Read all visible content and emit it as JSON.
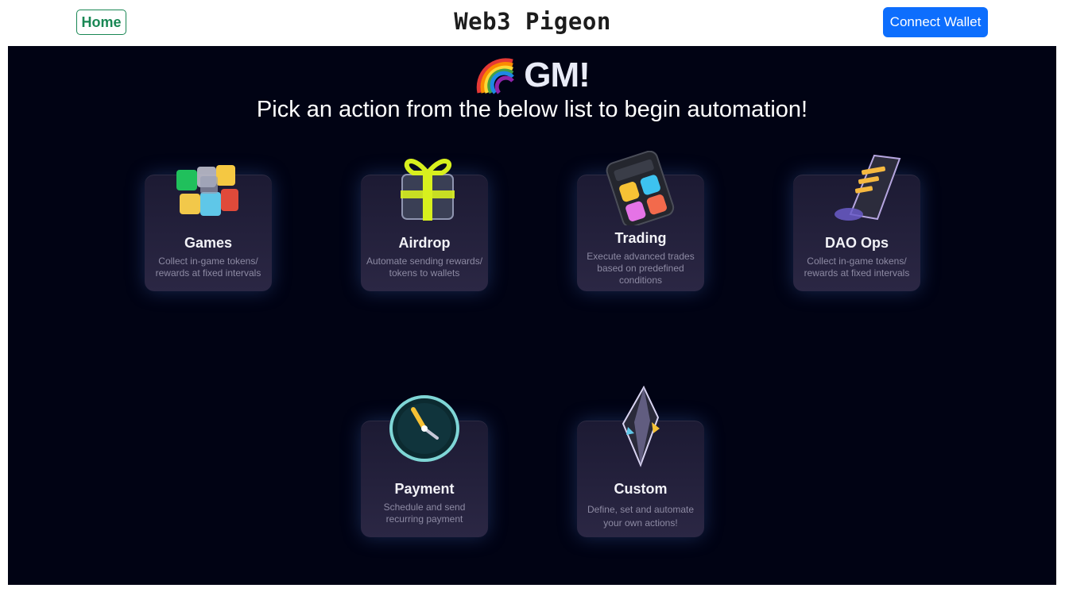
{
  "navbar": {
    "home_label": "Home",
    "brand": "Web3 Pigeon",
    "connect_label": "Connect Wallet"
  },
  "hero": {
    "greeting": "GM!",
    "subtitle": "Pick an action from the below list to begin automation!",
    "icon": "rainbow-icon"
  },
  "actions": [
    {
      "title": "Games",
      "description": "Collect in-game tokens/ rewards at fixed intervals",
      "icon": "cube-icon"
    },
    {
      "title": "Airdrop",
      "description": "Automate sending rewards/ tokens to wallets",
      "icon": "gift-icon"
    },
    {
      "title": "Trading",
      "description": "Execute advanced trades based on predefined conditions",
      "icon": "calculator-icon"
    },
    {
      "title": "DAO Ops",
      "description": "Collect in-game tokens/ rewards at fixed intervals",
      "icon": "scroll-icon"
    },
    {
      "title": "Payment",
      "description": "Schedule and send recurring payment",
      "icon": "clock-icon"
    },
    {
      "title": "Custom",
      "description": "Define, set and automate your own actions!",
      "icon": "crystal-icon"
    }
  ],
  "colors": {
    "stage_background": "#010314",
    "home_outline": "#198754",
    "connect_button": "#0d6efd"
  }
}
